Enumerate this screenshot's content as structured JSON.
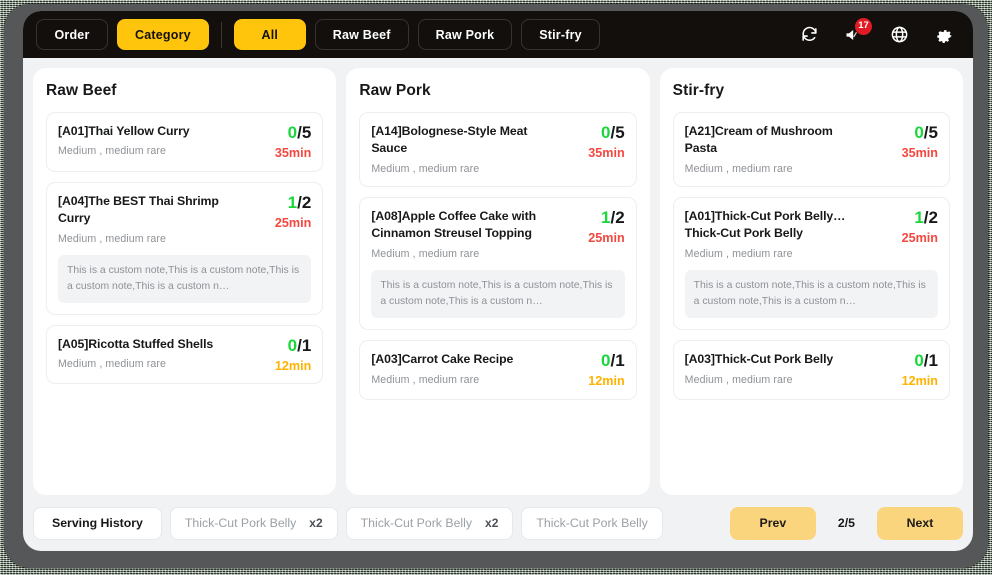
{
  "header": {
    "tabs": [
      {
        "label": "Order",
        "active": false
      },
      {
        "label": "Category",
        "active": true
      }
    ],
    "filters": [
      {
        "label": "All",
        "active": true
      },
      {
        "label": "Raw Beef",
        "active": false
      },
      {
        "label": "Raw Pork",
        "active": false
      },
      {
        "label": "Stir-fry",
        "active": false
      }
    ],
    "icons": [
      {
        "name": "refresh-icon",
        "badge": null
      },
      {
        "name": "announcement-icon",
        "badge": "17"
      },
      {
        "name": "globe-icon",
        "badge": null
      },
      {
        "name": "gear-icon",
        "badge": null
      }
    ]
  },
  "columns": [
    {
      "title": "Raw Beef",
      "items": [
        {
          "name": "[A01]Thai Yellow Curry",
          "name2": "",
          "options": "Medium , medium rare",
          "done": "0",
          "total": "5",
          "time": "35min",
          "time_color": "red",
          "note": ""
        },
        {
          "name": "[A04]The BEST Thai Shrimp",
          "name2": "Curry",
          "options": "Medium , medium rare",
          "done": "1",
          "total": "2",
          "time": "25min",
          "time_color": "red",
          "note": "This is a custom note,This is a custom note,This is a custom note,This is a custom n…"
        },
        {
          "name": "[A05]Ricotta Stuffed Shells",
          "name2": "",
          "options": "Medium , medium rare",
          "done": "0",
          "total": "1",
          "time": "12min",
          "time_color": "amber",
          "note": ""
        }
      ]
    },
    {
      "title": "Raw Pork",
      "items": [
        {
          "name": "[A14]Bolognese-Style Meat",
          "name2": "Sauce",
          "options": "Medium , medium rare",
          "done": "0",
          "total": "5",
          "time": "35min",
          "time_color": "red",
          "note": ""
        },
        {
          "name": "[A08]Apple Coffee Cake with",
          "name2": "Cinnamon Streusel Topping",
          "options": "Medium , medium rare",
          "done": "1",
          "total": "2",
          "time": "25min",
          "time_color": "red",
          "note": "This is a custom note,This is a custom note,This is a custom note,This is a custom n…"
        },
        {
          "name": "[A03]Carrot Cake Recipe",
          "name2": "",
          "options": "Medium , medium rare",
          "done": "0",
          "total": "1",
          "time": "12min",
          "time_color": "amber",
          "note": ""
        }
      ]
    },
    {
      "title": "Stir-fry",
      "items": [
        {
          "name": "[A21]Cream of Mushroom",
          "name2": "Pasta",
          "options": "Medium , medium rare",
          "done": "0",
          "total": "5",
          "time": "35min",
          "time_color": "red",
          "note": ""
        },
        {
          "name": "[A01]Thick-Cut Pork Belly…",
          "name2": "Thick-Cut Pork Belly",
          "options": "Medium , medium rare",
          "done": "1",
          "total": "2",
          "time": "25min",
          "time_color": "red",
          "note": "This is a custom note,This is a custom note,This is a custom note,This is a custom n…"
        },
        {
          "name": "[A03]Thick-Cut Pork Belly",
          "name2": "",
          "options": "Medium , medium rare",
          "done": "0",
          "total": "1",
          "time": "12min",
          "time_color": "amber",
          "note": ""
        }
      ]
    }
  ],
  "footer": {
    "history_label": "Serving History",
    "chips": [
      {
        "label": "Thick-Cut Pork Belly",
        "qty": "x2"
      },
      {
        "label": "Thick-Cut Pork Belly",
        "qty": "x2"
      },
      {
        "label": "Thick-Cut Pork Belly",
        "qty": ""
      }
    ],
    "prev_label": "Prev",
    "page_indicator": "2/5",
    "next_label": "Next"
  },
  "colors": {
    "accent_yellow": "#ffc40c",
    "pager_yellow": "#fad57e",
    "done_green": "#19d73a",
    "time_red": "#f4473f",
    "time_amber": "#ffb200",
    "badge_red": "#e01b24",
    "header_black": "#120f0c",
    "page_bg": "#f1f2f4"
  }
}
